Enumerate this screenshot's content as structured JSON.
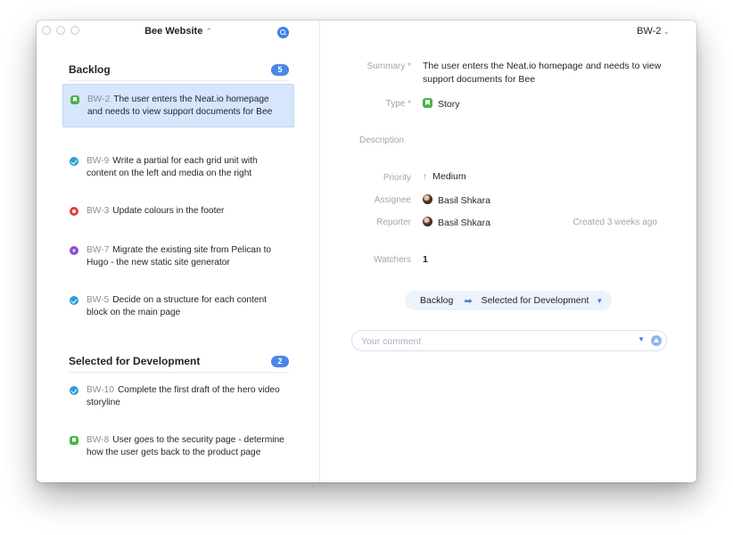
{
  "window": {
    "project_title": "Bee Website",
    "project_chevron": "⌃"
  },
  "sections": [
    {
      "name": "Backlog",
      "count": "5",
      "issues": [
        {
          "key": "BW-2",
          "summary": "The user enters the Neat.io homepage and needs to view support documents for Bee",
          "type": "story-icon",
          "selected": true
        },
        {
          "key": "BW-9",
          "summary": "Write a partial for each grid unit with content on the left and media on the right",
          "type": "task-icon"
        },
        {
          "key": "BW-3",
          "summary": "Update colours in the footer",
          "type": "bug-icon"
        },
        {
          "key": "BW-7",
          "summary": "Migrate the existing site from Pelican to Hugo - the new static site generator",
          "type": "epic-icon"
        },
        {
          "key": "BW-5",
          "summary": "Decide on a structure for each content block on the main page",
          "type": "task-icon"
        }
      ]
    },
    {
      "name": "Selected for Development",
      "count": "2",
      "issues": [
        {
          "key": "BW-10",
          "summary": "Complete the first draft of the hero video storyline",
          "type": "task-icon"
        },
        {
          "key": "BW-8",
          "summary": "User goes to the security page - determine how the user gets back to the product page",
          "type": "story-icon"
        }
      ]
    }
  ],
  "detail": {
    "issue_key": "BW-2",
    "summary_label": "Summary *",
    "summary": "The user enters the Neat.io homepage and needs to view support documents for Bee",
    "type_label": "Type *",
    "type": "Story",
    "description_label": "Description",
    "priority_label": "Priority",
    "priority": "Medium",
    "assignee_label": "Assignee",
    "assignee": "Basil Shkara",
    "reporter_label": "Reporter",
    "reporter": "Basil Shkara",
    "created": "Created 3 weeks ago",
    "watchers_label": "Watchers",
    "watchers": "1",
    "transition_from": "Backlog",
    "transition_to": "Selected for Development",
    "comment_placeholder": "Your comment"
  },
  "colors": {
    "accent": "#3f7fe6",
    "selected_bg": "#d6e6fc",
    "story": "#48b449",
    "task": "#2d9dd8",
    "bug": "#e1413a",
    "epic": "#8e4bd6",
    "priority_medium": "#f07a1a"
  }
}
